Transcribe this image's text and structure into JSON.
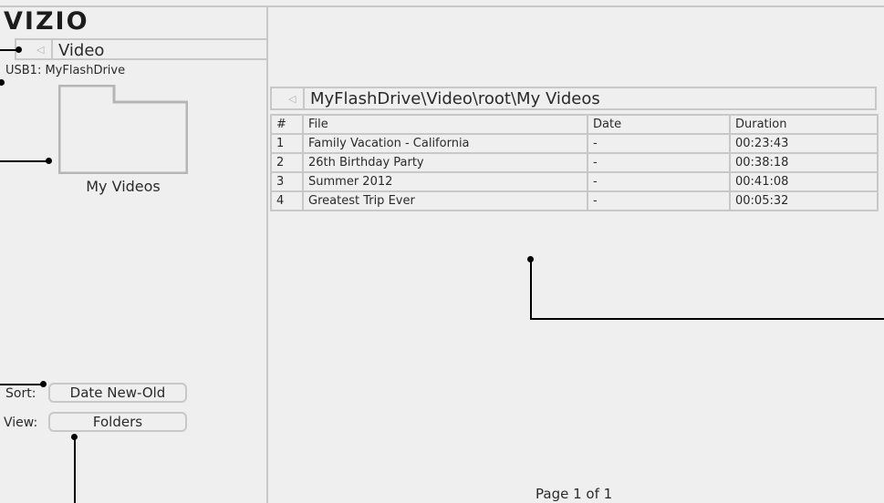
{
  "brand": "VIZIO",
  "breadcrumb": {
    "label": "Video"
  },
  "source": "USB1: MyFlashDrive",
  "folder": {
    "name": "My Videos"
  },
  "controls": {
    "sort_label": "Sort:",
    "sort_value": "Date New-Old",
    "view_label": "View:",
    "view_value": "Folders"
  },
  "path": "MyFlashDrive\\Video\\root\\My Videos",
  "table": {
    "headers": [
      "#",
      "File",
      "Date",
      "Duration"
    ],
    "rows": [
      [
        "1",
        "Family Vacation - California",
        "-",
        "00:23:43"
      ],
      [
        "2",
        "26th Birthday Party",
        "-",
        "00:38:18"
      ],
      [
        "3",
        "Summer 2012",
        "-",
        "00:41:08"
      ],
      [
        "4",
        "Greatest Trip Ever",
        "-",
        "00:05:32"
      ]
    ]
  },
  "pagination": "Page 1 of 1",
  "colors": {
    "background": "#efefef",
    "border": "#c8c8c8",
    "text": "#2a2a2a",
    "callout": "#000000"
  }
}
